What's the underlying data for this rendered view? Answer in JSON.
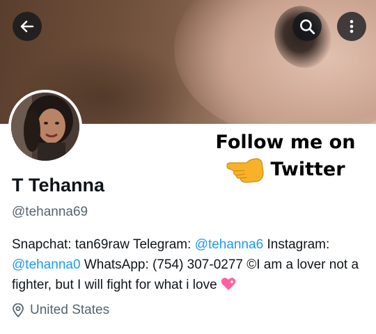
{
  "header": {
    "back_icon": "arrow-left-icon",
    "search_icon": "search-icon",
    "more_icon": "more-vertical-icon"
  },
  "promo": {
    "line1": "Follow me on",
    "line2": "Twitter",
    "emoji": "backhand-index-pointing-right"
  },
  "profile": {
    "display_name": "T Tehanna",
    "handle": "@tehanna69",
    "bio": {
      "part1": "Snapchat: tan69raw Telegram: ",
      "mention1": "@tehanna6",
      "part2": " Instagram: ",
      "mention2": "@tehanna0",
      "part3": " WhatsApp: (754) 307-0277  ©I am a lover not a fighter, but I will fight for what i love",
      "emoji": "sparkling-heart"
    },
    "location": "United States",
    "location_icon": "location-pin-icon"
  },
  "colors": {
    "link": "#1d9bf0",
    "secondary_text": "#536471",
    "primary_text": "#0f1419"
  }
}
